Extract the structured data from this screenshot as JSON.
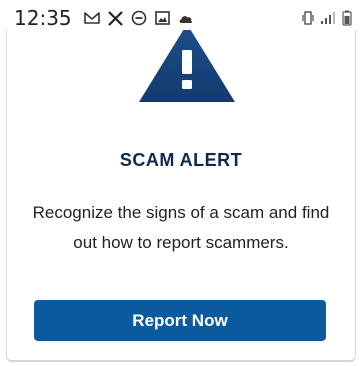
{
  "status_bar": {
    "time": "12:35",
    "left_icons": [
      "gmail-icon",
      "x-icon",
      "do-not-disturb-icon",
      "image-icon",
      "cloud-icon"
    ],
    "right_icons": [
      "vibrate-icon",
      "signal-icon",
      "battery-icon"
    ]
  },
  "alert_card": {
    "icon": "warning-icon",
    "title": "SCAM ALERT",
    "description": "Recognize the signs of a scam and find out how to report scammers.",
    "button_label": "Report Now"
  },
  "colors": {
    "accent": "#0b5a9e",
    "title": "#0c2a4d",
    "icon_gradient_top": "#1e4f8c",
    "icon_gradient_bottom": "#123a6e"
  }
}
